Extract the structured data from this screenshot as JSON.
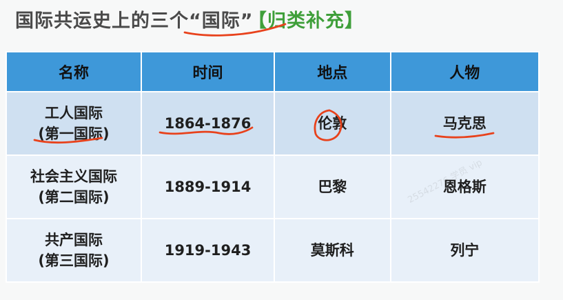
{
  "title": {
    "main": "国际共运史上的三个“国际”",
    "tag": "【归类补充】"
  },
  "table": {
    "headers": [
      "名称",
      "时间",
      "地点",
      "人物"
    ],
    "rows": [
      {
        "name_line1": "工人国际",
        "name_line2": "(第一国际)",
        "time": "1864-1876",
        "place": "伦敦",
        "person": "马克思"
      },
      {
        "name_line1": "社会主义国际",
        "name_line2": "(第二国际)",
        "time": "1889-1914",
        "place": "巴黎",
        "person": "恩格斯"
      },
      {
        "name_line1": "共产国际",
        "name_line2": "(第三国际)",
        "time": "1919-1943",
        "place": "莫斯科",
        "person": "列宁"
      }
    ]
  },
  "watermark": {
    "text": "25542276 学员 vip"
  },
  "colors": {
    "header_bg": "#3e98d9",
    "row_odd_bg": "#cfe0f1",
    "row_even_bg": "#e8f0f9",
    "title_tag": "#3f9f3a",
    "annotation": "#e8421c"
  }
}
